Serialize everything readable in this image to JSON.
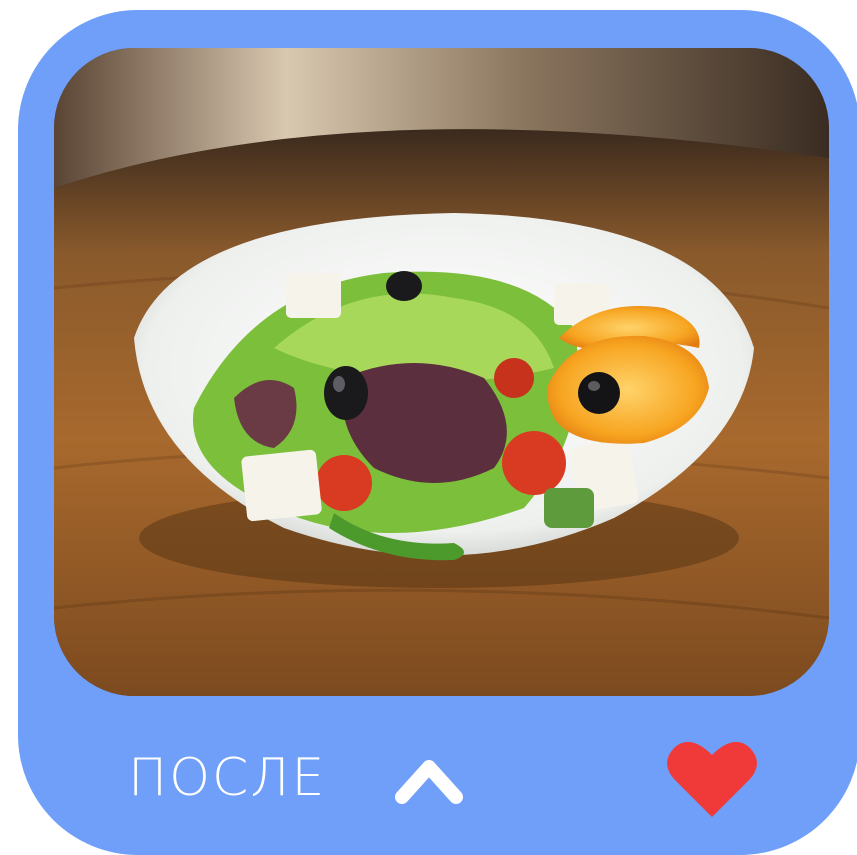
{
  "card": {
    "label": "ПОСЛЕ",
    "accent_color": "#6f9ff8",
    "photo_subject": "salad-bowl-photo",
    "controls": {
      "expand_icon": "chevron-up-icon",
      "like_icon": "heart-icon",
      "like_color": "#f03a3a"
    }
  }
}
